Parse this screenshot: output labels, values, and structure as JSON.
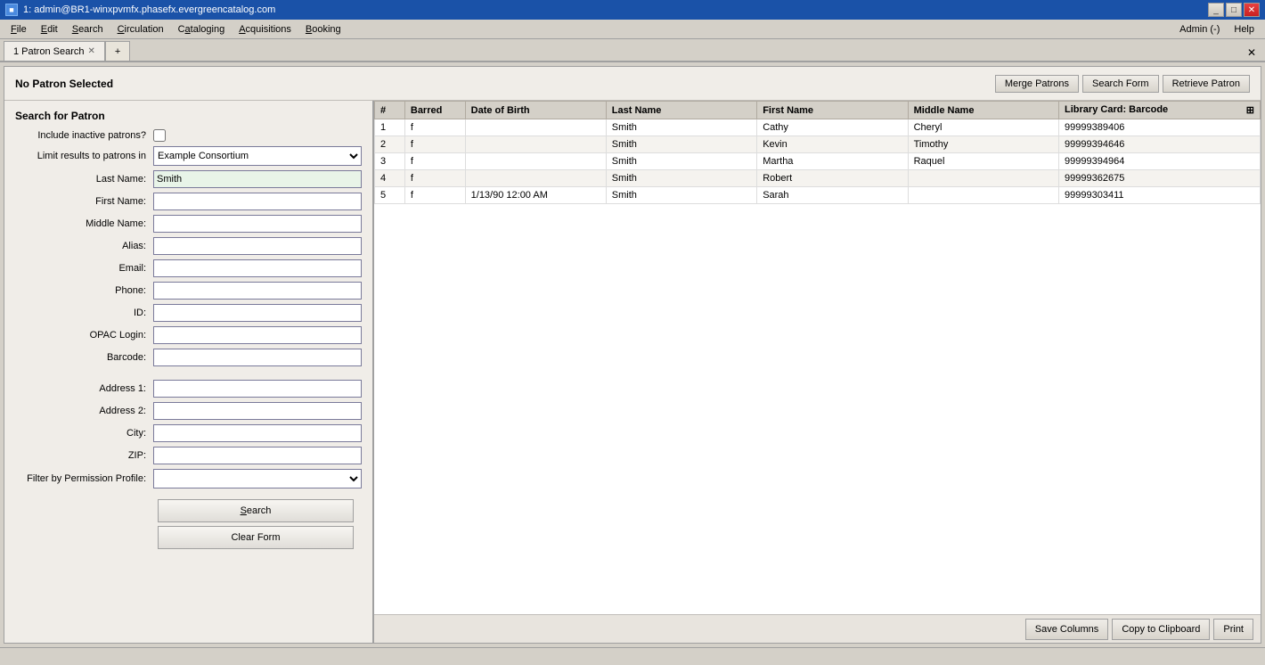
{
  "titlebar": {
    "title": "1: admin@BR1-winxpvmfx.phasefx.evergreencatalog.com",
    "controls": [
      "minimize",
      "maximize",
      "close"
    ]
  },
  "menubar": {
    "items": [
      {
        "label": "File",
        "underline": "F"
      },
      {
        "label": "Edit",
        "underline": "E"
      },
      {
        "label": "Search",
        "underline": "S"
      },
      {
        "label": "Circulation",
        "underline": "C"
      },
      {
        "label": "Cataloging",
        "underline": "a"
      },
      {
        "label": "Acquisitions",
        "underline": "A"
      },
      {
        "label": "Booking",
        "underline": "B"
      }
    ],
    "right_items": [
      "Admin (-)",
      "Help"
    ]
  },
  "tabs": [
    {
      "label": "1 Patron Search",
      "active": true
    },
    {
      "label": "+"
    }
  ],
  "header": {
    "no_patron_label": "No Patron Selected",
    "buttons": [
      {
        "label": "Merge Patrons"
      },
      {
        "label": "Search Form"
      },
      {
        "label": "Retrieve Patron"
      }
    ]
  },
  "search_form": {
    "section_title": "Search for Patron",
    "fields": [
      {
        "label": "Include inactive patrons?",
        "type": "checkbox",
        "name": "include-inactive"
      },
      {
        "label": "Limit results to patrons in",
        "type": "select",
        "name": "limit-results",
        "value": "Example Consortium"
      },
      {
        "label": "Last Name:",
        "type": "text",
        "name": "last-name",
        "value": "Smith"
      },
      {
        "label": "First Name:",
        "type": "text",
        "name": "first-name",
        "value": ""
      },
      {
        "label": "Middle Name:",
        "type": "text",
        "name": "middle-name",
        "value": ""
      },
      {
        "label": "Alias:",
        "type": "text",
        "name": "alias",
        "value": ""
      },
      {
        "label": "Email:",
        "type": "text",
        "name": "email",
        "value": ""
      },
      {
        "label": "Phone:",
        "type": "text",
        "name": "phone",
        "value": ""
      },
      {
        "label": "ID:",
        "type": "text",
        "name": "id-field",
        "value": ""
      },
      {
        "label": "OPAC Login:",
        "type": "text",
        "name": "opac-login",
        "value": ""
      },
      {
        "label": "Barcode:",
        "type": "text",
        "name": "barcode",
        "value": ""
      },
      {
        "label": "Address 1:",
        "type": "text",
        "name": "address1",
        "value": ""
      },
      {
        "label": "Address 2:",
        "type": "text",
        "name": "address2",
        "value": ""
      },
      {
        "label": "City:",
        "type": "text",
        "name": "city",
        "value": ""
      },
      {
        "label": "ZIP:",
        "type": "text",
        "name": "zip",
        "value": ""
      },
      {
        "label": "Filter by Permission Profile:",
        "type": "select",
        "name": "permission-profile",
        "value": ""
      }
    ],
    "buttons": [
      {
        "label": "Search",
        "name": "search-button"
      },
      {
        "label": "Clear Form",
        "name": "clear-form-button"
      }
    ]
  },
  "results_table": {
    "columns": [
      {
        "label": "#",
        "name": "col-num"
      },
      {
        "label": "Barred",
        "name": "col-barred"
      },
      {
        "label": "Date of Birth",
        "name": "col-dob"
      },
      {
        "label": "Last Name",
        "name": "col-last"
      },
      {
        "label": "First Name",
        "name": "col-first"
      },
      {
        "label": "Middle Name",
        "name": "col-middle"
      },
      {
        "label": "Library Card: Barcode",
        "name": "col-libcard"
      }
    ],
    "rows": [
      {
        "num": "1",
        "barred": "f",
        "dob": "",
        "last": "Smith",
        "first": "Cathy",
        "middle": "Cheryl",
        "barcode": "99999389406"
      },
      {
        "num": "2",
        "barred": "f",
        "dob": "",
        "last": "Smith",
        "first": "Kevin",
        "middle": "Timothy",
        "barcode": "99999394646"
      },
      {
        "num": "3",
        "barred": "f",
        "dob": "",
        "last": "Smith",
        "first": "Martha",
        "middle": "Raquel",
        "barcode": "99999394964"
      },
      {
        "num": "4",
        "barred": "f",
        "dob": "",
        "last": "Smith",
        "first": "Robert",
        "middle": "",
        "barcode": "99999362675"
      },
      {
        "num": "5",
        "barred": "f",
        "dob": "1/13/90 12:00 AM",
        "last": "Smith",
        "first": "Sarah",
        "middle": "",
        "barcode": "99999303411"
      }
    ]
  },
  "bottom_bar": {
    "buttons": [
      {
        "label": "Save Columns",
        "name": "save-columns-button"
      },
      {
        "label": "Copy to Clipboard",
        "name": "copy-clipboard-button"
      },
      {
        "label": "Print",
        "name": "print-button"
      }
    ]
  }
}
